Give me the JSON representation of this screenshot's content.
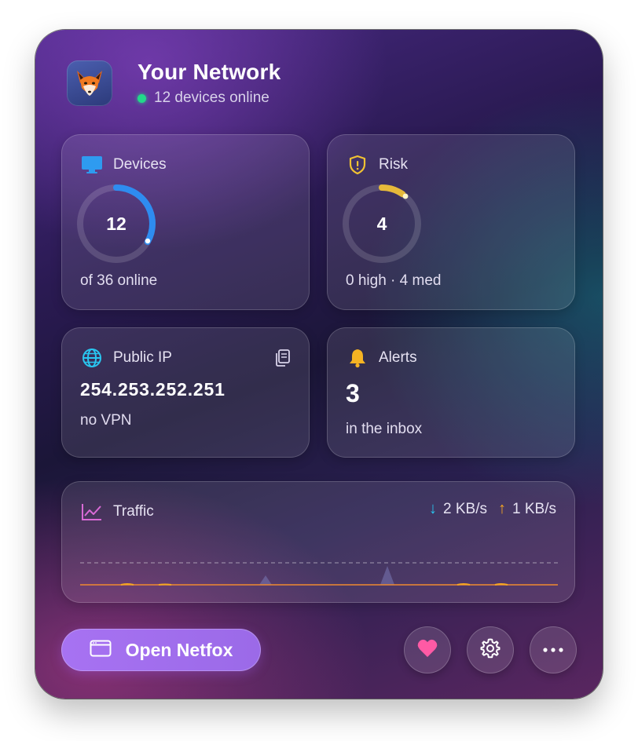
{
  "header": {
    "title": "Your Network",
    "status": "12 devices online",
    "status_color": "#22d88a",
    "app_icon": "fox-icon"
  },
  "devices": {
    "label": "Devices",
    "icon": "monitor-icon",
    "value": "12",
    "total": 36,
    "footer": "of 36 online",
    "accent": "#2e8cf0"
  },
  "risk": {
    "label": "Risk",
    "icon": "shield-alert-icon",
    "value": "4",
    "footer": "0 high · 4 med",
    "accent": "#f1c232"
  },
  "public_ip": {
    "label": "Public IP",
    "icon": "globe-icon",
    "value": "254.253.252.251",
    "footer": "no VPN",
    "copy_icon": "copy-icon"
  },
  "alerts": {
    "label": "Alerts",
    "icon": "bell-icon",
    "value": "3",
    "footer": "in the inbox"
  },
  "traffic": {
    "label": "Traffic",
    "icon": "line-chart-icon",
    "down": "2 KB/s",
    "up": "1 KB/s",
    "down_color": "#29c6f0",
    "up_color": "#f5a623"
  },
  "footer": {
    "open_label": "Open Netfox",
    "buttons": [
      "heart-icon",
      "gear-icon",
      "more-icon"
    ]
  }
}
